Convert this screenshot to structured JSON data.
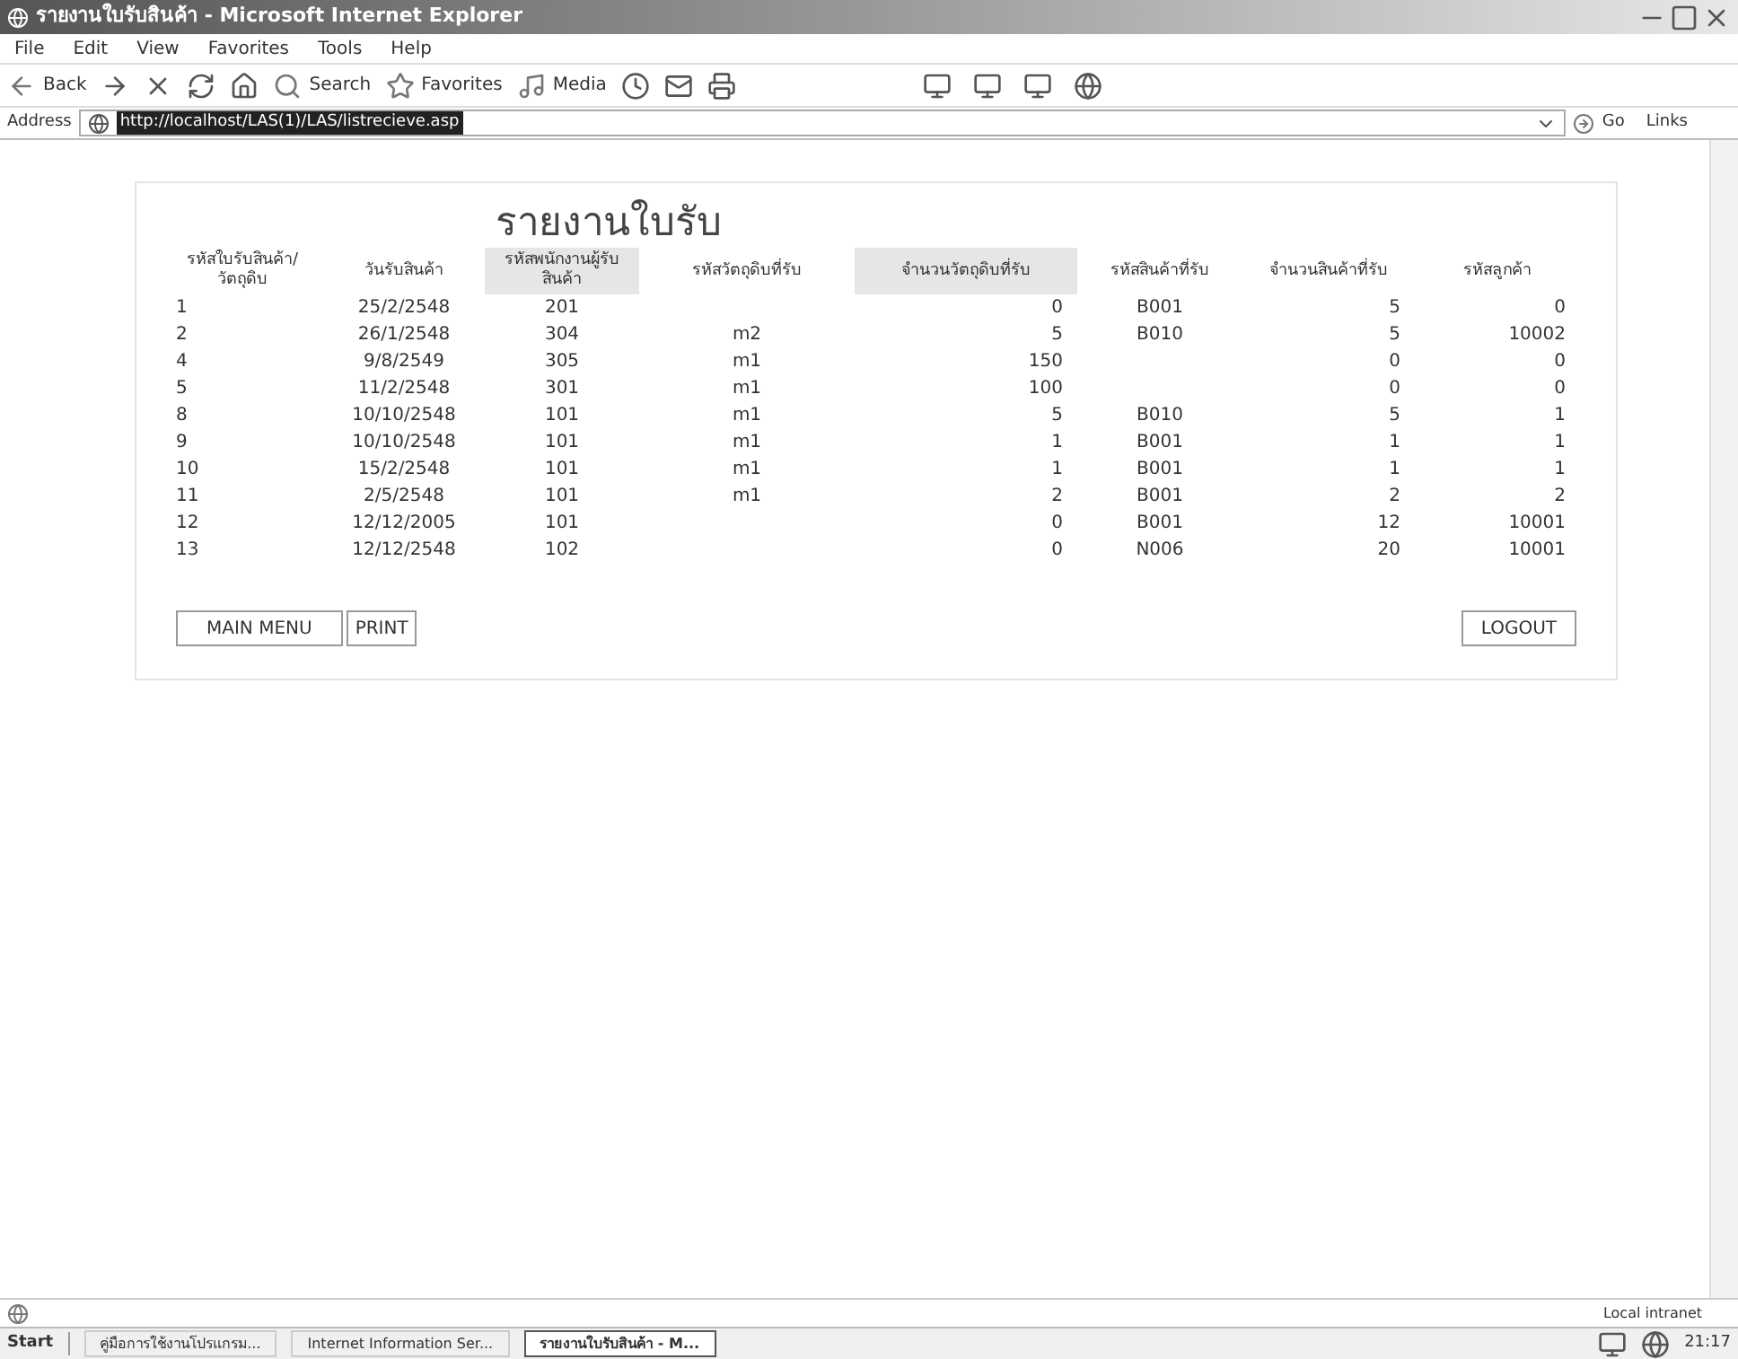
{
  "window": {
    "title": "รายงานใบรับสินค้า - Microsoft Internet Explorer"
  },
  "menu": [
    "File",
    "Edit",
    "View",
    "Favorites",
    "Tools",
    "Help"
  ],
  "toolbar": {
    "back": "Back",
    "search": "Search",
    "favorites": "Favorites",
    "media": "Media"
  },
  "address": {
    "label": "Address",
    "value": "http://localhost/LAS(1)/LAS/listrecieve.asp",
    "go": "Go",
    "links": "Links"
  },
  "page": {
    "heading": "รายงานใบรับ",
    "columns": [
      {
        "label": "รหัสใบรับสินค้า/วัตถุดิบ",
        "shaded": false
      },
      {
        "label": "วันรับสินค้า",
        "shaded": false
      },
      {
        "label": "รหัสพนักงานผู้รับสินค้า",
        "shaded": true
      },
      {
        "label": "รหัสวัตถุดิบที่รับ",
        "shaded": false
      },
      {
        "label": "จำนวนวัตถุดิบที่รับ",
        "shaded": true
      },
      {
        "label": "รหัสสินค้าที่รับ",
        "shaded": false
      },
      {
        "label": "จำนวนสินค้าที่รับ",
        "shaded": false
      },
      {
        "label": "รหัสลูกค้า",
        "shaded": false
      }
    ],
    "rows": [
      [
        "1",
        "25/2/2548",
        "201",
        "",
        "0",
        "B001",
        "5",
        "0"
      ],
      [
        "2",
        "26/1/2548",
        "304",
        "m2",
        "5",
        "B010",
        "5",
        "10002"
      ],
      [
        "4",
        "9/8/2549",
        "305",
        "m1",
        "150",
        "",
        "0",
        "0"
      ],
      [
        "5",
        "11/2/2548",
        "301",
        "m1",
        "100",
        "",
        "0",
        "0"
      ],
      [
        "8",
        "10/10/2548",
        "101",
        "m1",
        "5",
        "B010",
        "5",
        "1"
      ],
      [
        "9",
        "10/10/2548",
        "101",
        "m1",
        "1",
        "B001",
        "1",
        "1"
      ],
      [
        "10",
        "15/2/2548",
        "101",
        "m1",
        "1",
        "B001",
        "1",
        "1"
      ],
      [
        "11",
        "2/5/2548",
        "101",
        "m1",
        "2",
        "B001",
        "2",
        "2"
      ],
      [
        "12",
        "12/12/2005",
        "101",
        "",
        "0",
        "B001",
        "12",
        "10001"
      ],
      [
        "13",
        "12/12/2548",
        "102",
        "",
        "0",
        "N006",
        "20",
        "10001"
      ]
    ],
    "buttons": [
      "MAIN MENU",
      "PRINT"
    ],
    "logout": "LOGOUT"
  },
  "status_bar": {
    "zone": "Local intranet"
  },
  "taskbar": {
    "start": "Start",
    "tasks": [
      {
        "label": "คู่มือการใช้งานโปรแกรม...",
        "selected": false
      },
      {
        "label": "Internet Information Ser...",
        "selected": false
      },
      {
        "label": "รายงานใบรับสินค้า - M...",
        "selected": true
      }
    ],
    "clock": "21:17"
  }
}
